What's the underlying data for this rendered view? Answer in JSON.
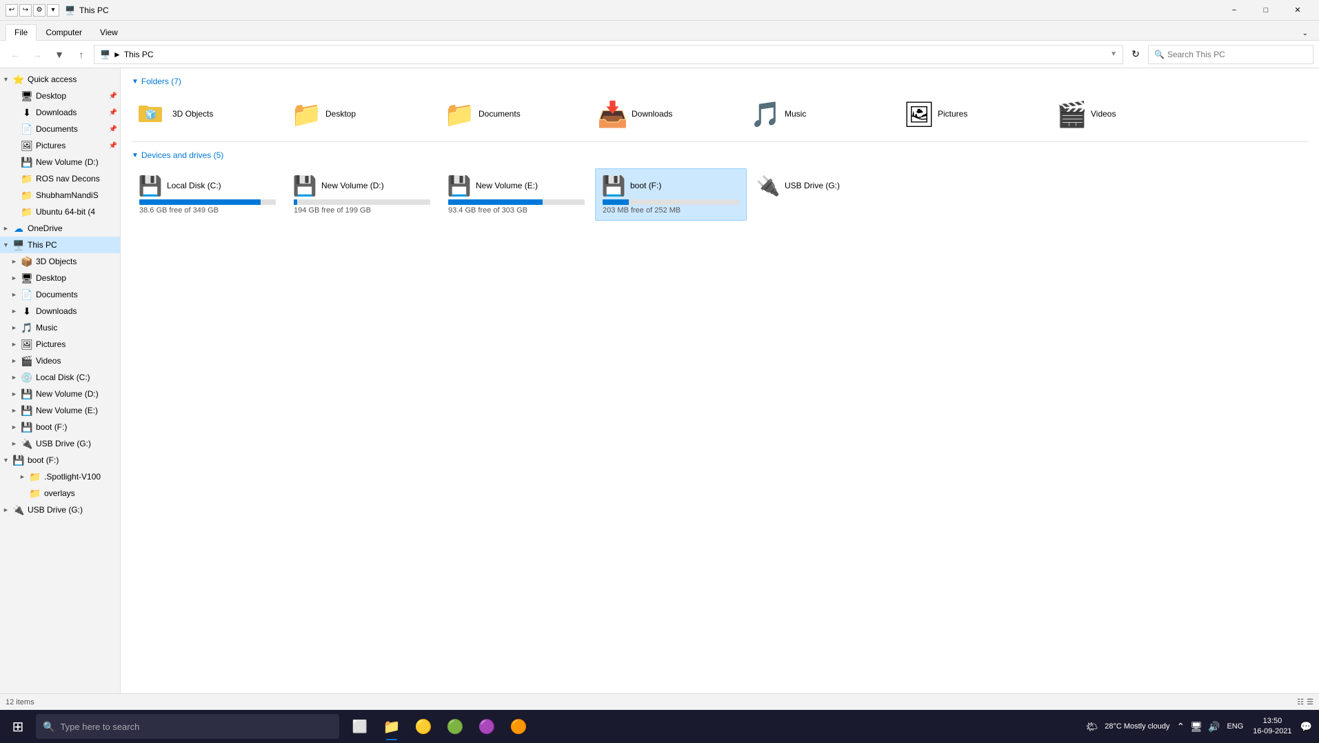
{
  "titleBar": {
    "title": "This PC",
    "quickAccessToolbar": [
      "undo",
      "redo",
      "properties"
    ],
    "buttons": [
      "minimize",
      "maximize",
      "close"
    ]
  },
  "ribbon": {
    "tabs": [
      "File",
      "Computer",
      "View"
    ],
    "activeTab": "File"
  },
  "addressBar": {
    "path": "This PC",
    "searchPlaceholder": "Search This PC"
  },
  "sidebar": {
    "sections": [
      {
        "name": "Quick access",
        "expanded": true,
        "items": [
          {
            "label": "Desktop",
            "pinned": true,
            "indent": 1
          },
          {
            "label": "Downloads",
            "pinned": true,
            "indent": 1
          },
          {
            "label": "Documents",
            "pinned": true,
            "indent": 1
          },
          {
            "label": "Pictures",
            "pinned": true,
            "indent": 1
          },
          {
            "label": "New Volume (D:)",
            "pinned": false,
            "indent": 1
          },
          {
            "label": "ROS nav Decons",
            "pinned": false,
            "indent": 1
          },
          {
            "label": "ShubhamNandiS",
            "pinned": false,
            "indent": 1
          },
          {
            "label": "Ubuntu 64-bit (4",
            "pinned": false,
            "indent": 1
          }
        ]
      },
      {
        "name": "OneDrive",
        "expanded": false,
        "indent": 0
      },
      {
        "name": "This PC",
        "expanded": true,
        "selected": true,
        "items": [
          {
            "label": "3D Objects",
            "indent": 1
          },
          {
            "label": "Desktop",
            "indent": 1
          },
          {
            "label": "Documents",
            "indent": 1
          },
          {
            "label": "Downloads",
            "indent": 1
          },
          {
            "label": "Music",
            "indent": 1
          },
          {
            "label": "Pictures",
            "indent": 1
          },
          {
            "label": "Videos",
            "indent": 1
          },
          {
            "label": "Local Disk (C:)",
            "indent": 1
          },
          {
            "label": "New Volume (D:)",
            "indent": 1
          },
          {
            "label": "New Volume (E:)",
            "indent": 1
          },
          {
            "label": "boot (F:)",
            "indent": 1
          },
          {
            "label": "USB Drive (G:)",
            "indent": 1
          }
        ]
      },
      {
        "name": "boot (F:)",
        "expanded": true,
        "indent": 0,
        "items": [
          {
            "label": ".Spotlight-V100",
            "indent": 2
          },
          {
            "label": "overlays",
            "indent": 2
          }
        ]
      },
      {
        "name": "USB Drive (G:)",
        "expanded": false,
        "indent": 0
      }
    ]
  },
  "content": {
    "foldersSection": {
      "label": "Folders (7)",
      "folders": [
        {
          "name": "3D Objects",
          "icon": "3d"
        },
        {
          "name": "Desktop",
          "icon": "desktop"
        },
        {
          "name": "Documents",
          "icon": "documents"
        },
        {
          "name": "Downloads",
          "icon": "downloads"
        },
        {
          "name": "Music",
          "icon": "music"
        },
        {
          "name": "Pictures",
          "icon": "pictures"
        },
        {
          "name": "Videos",
          "icon": "videos"
        }
      ]
    },
    "devicesSection": {
      "label": "Devices and drives (5)",
      "drives": [
        {
          "name": "Local Disk (C:)",
          "free": "38.6 GB free of 349 GB",
          "freeGB": 38.6,
          "totalGB": 349,
          "usedPercent": 88.9,
          "warning": false
        },
        {
          "name": "New Volume (D:)",
          "free": "194 GB free of 199 GB",
          "freeGB": 194,
          "totalGB": 199,
          "usedPercent": 2.5,
          "warning": false
        },
        {
          "name": "New Volume (E:)",
          "free": "93.4 GB free of 303 GB",
          "freeGB": 93.4,
          "totalGB": 303,
          "usedPercent": 69.2,
          "warning": false
        },
        {
          "name": "boot (F:)",
          "free": "203 MB free of 252 MB",
          "freeGB": 0.203,
          "totalGB": 0.252,
          "usedPercent": 19.4,
          "warning": false,
          "selected": true
        },
        {
          "name": "USB Drive (G:)",
          "free": "",
          "freeGB": 0,
          "totalGB": 0,
          "usedPercent": 0,
          "warning": false
        }
      ]
    }
  },
  "statusBar": {
    "count": "12 items"
  },
  "taskbar": {
    "searchPlaceholder": "Type here to search",
    "time": "13:50",
    "date": "16-09-2021",
    "weather": "28°C  Mostly cloudy",
    "language": "ENG",
    "apps": [
      {
        "name": "start",
        "icon": "⊞"
      },
      {
        "name": "search",
        "icon": "🔍"
      },
      {
        "name": "task-view",
        "icon": "⬜"
      },
      {
        "name": "file-explorer",
        "icon": "📁",
        "active": true
      },
      {
        "name": "chrome-icon1",
        "icon": "◉"
      },
      {
        "name": "chrome",
        "icon": "◎"
      },
      {
        "name": "app5",
        "icon": "✚"
      },
      {
        "name": "app6",
        "icon": "⬛"
      }
    ]
  }
}
